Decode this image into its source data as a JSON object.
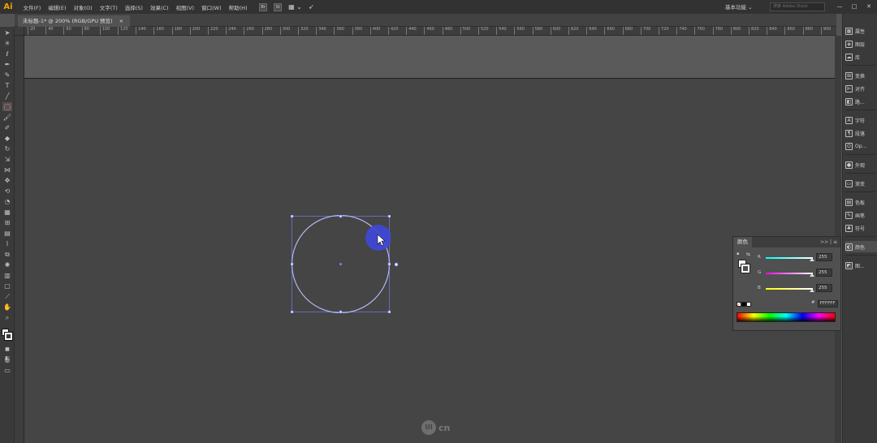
{
  "app": {
    "logo": "Ai"
  },
  "menu": [
    "文件(F)",
    "编辑(E)",
    "对象(O)",
    "文字(T)",
    "选择(S)",
    "效果(C)",
    "视图(V)",
    "窗口(W)",
    "帮助(H)"
  ],
  "menubar_icons": [
    "Br",
    "St"
  ],
  "workspace": {
    "label": "基本功能"
  },
  "search": {
    "placeholder": "搜索 Adobe Stock"
  },
  "window_buttons": [
    "—",
    "□",
    "✕"
  ],
  "document_tab": {
    "title": "未标题-1* @ 200% (RGB/GPU 预览)",
    "close": "×"
  },
  "ruler_ticks": [
    "20",
    "40",
    "60",
    "80",
    "100",
    "120",
    "140",
    "160",
    "180",
    "200",
    "220",
    "240",
    "260",
    "280",
    "300",
    "320",
    "340",
    "360",
    "380",
    "400",
    "420",
    "440",
    "460",
    "480",
    "500",
    "520",
    "540",
    "560",
    "580",
    "600",
    "620",
    "640",
    "660",
    "680",
    "700",
    "720",
    "740",
    "760",
    "780",
    "800",
    "820",
    "840",
    "860",
    "880",
    "900"
  ],
  "dock": {
    "items": [
      {
        "label": "属性",
        "icon": "properties-icon",
        "glyph": "▦"
      },
      {
        "label": "图层",
        "icon": "layers-icon",
        "glyph": "◈"
      },
      {
        "label": "库",
        "icon": "libraries-icon",
        "glyph": "☁"
      },
      {
        "label": "变换",
        "icon": "transform-icon",
        "glyph": "⊞"
      },
      {
        "label": "对齐",
        "icon": "align-icon",
        "glyph": "⊫"
      },
      {
        "label": "路...",
        "icon": "pathfinder-icon",
        "glyph": "◧"
      },
      {
        "label": "字符",
        "icon": "character-icon",
        "glyph": "A"
      },
      {
        "label": "段落",
        "icon": "paragraph-icon",
        "glyph": "¶"
      },
      {
        "label": "Op...",
        "icon": "opentype-icon",
        "glyph": "O"
      },
      {
        "label": "外观",
        "icon": "appearance-icon",
        "glyph": "●"
      },
      {
        "label": "渐变",
        "icon": "gradient-icon",
        "glyph": "▭"
      },
      {
        "label": "色板",
        "icon": "swatches-icon",
        "glyph": "▤"
      },
      {
        "label": "画笔",
        "icon": "brushes-icon",
        "glyph": "✎"
      },
      {
        "label": "符号",
        "icon": "symbols-icon",
        "glyph": "♣"
      },
      {
        "label": "颜色",
        "icon": "color-icon",
        "glyph": "◐"
      },
      {
        "label": "图...",
        "icon": "graphic-styles-icon",
        "glyph": "◩"
      }
    ]
  },
  "color_panel": {
    "title": "颜色",
    "menu": ">> | ≡",
    "channels": [
      {
        "label": "R",
        "value": "255",
        "gradient": "linear-gradient(to right,#00ffff,#ffffff)"
      },
      {
        "label": "G",
        "value": "255",
        "gradient": "linear-gradient(to right,#ff00ff,#ffffff)"
      },
      {
        "label": "B",
        "value": "255",
        "gradient": "linear-gradient(to right,#ffff00,#ffffff)"
      }
    ],
    "hex_label": "#",
    "hex_value": "FFFFFF"
  },
  "watermark": {
    "mark": "UI",
    "text": "cn"
  },
  "colors": {
    "selection": "#7b82e8",
    "cursor_highlight": "#3f49d8",
    "menubar": "#323232",
    "canvas": "#454545"
  }
}
